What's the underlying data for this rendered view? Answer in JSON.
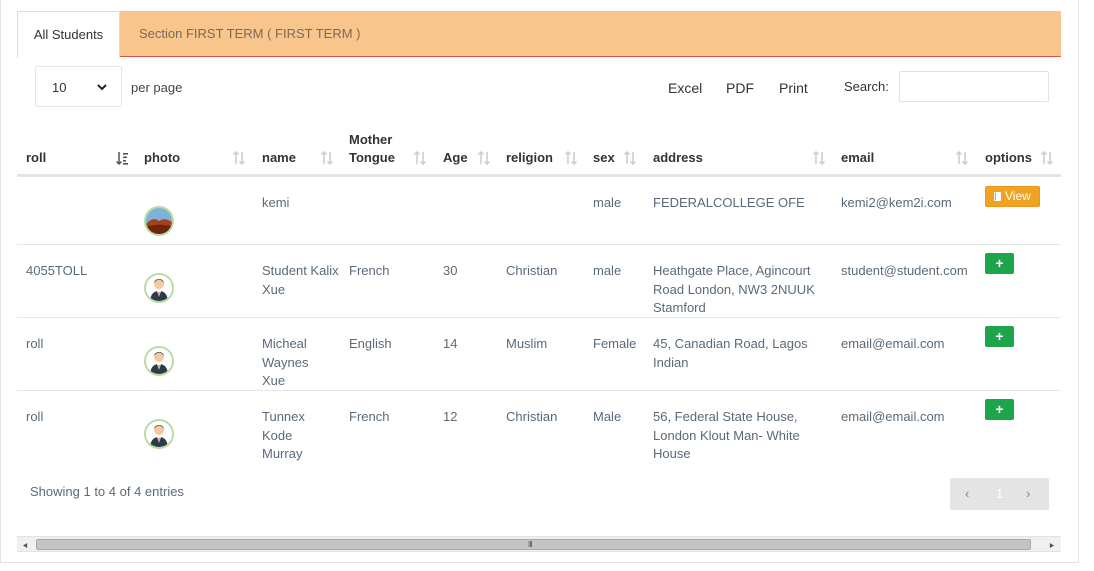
{
  "tabs": {
    "all_students": "All Students",
    "section": "Section FIRST TERM ( FIRST TERM )"
  },
  "controls": {
    "page_length": "10",
    "per_page_label": "per page",
    "excel": "Excel",
    "pdf": "PDF",
    "print": "Print",
    "search_label": "Search:",
    "search_value": ""
  },
  "table": {
    "columns": [
      "roll",
      "photo",
      "name",
      "Mother Tongue",
      "Age",
      "religion",
      "sex",
      "address",
      "email",
      "options"
    ],
    "mother_tongue_line1": "Mother",
    "mother_tongue_line2": "Tongue",
    "rows": [
      {
        "roll": "",
        "name": "kemi",
        "mother_tongue": "",
        "age": "",
        "religion": "",
        "sex": "male",
        "address": "FEDERALCOLLEGE OFE",
        "email": "kemi2@kem2i.com",
        "option": "View",
        "option_type": "view",
        "avatar": "landscape-photo-icon"
      },
      {
        "roll": "4055TOLL",
        "name": "Student Kalix Xue",
        "mother_tongue": "French",
        "age": "30",
        "religion": "Christian",
        "sex": "male",
        "address": "Heathgate Place, Agincourt Road London, NW3 2NUUK Stamford",
        "email": "student@student.com",
        "option": "+",
        "option_type": "add",
        "avatar": "person-icon"
      },
      {
        "roll": "roll",
        "name": "Micheal Waynes Xue",
        "mother_tongue": "English",
        "age": "14",
        "religion": "Muslim",
        "sex": "Female",
        "address": "45, Canadian Road, Lagos Indian",
        "email": "email@email.com",
        "option": "+",
        "option_type": "add",
        "avatar": "person-icon"
      },
      {
        "roll": "roll",
        "name": "Tunnex Kode Murray",
        "mother_tongue": "French",
        "age": "12",
        "religion": "Christian",
        "sex": "Male",
        "address": "56, Federal State House, London Klout Man- White House",
        "email": "email@email.com",
        "option": "+",
        "option_type": "add",
        "avatar": "person-icon"
      }
    ]
  },
  "footer": {
    "info": "Showing 1 to 4 of 4 entries",
    "prev": "‹",
    "page": "1",
    "next": "›"
  },
  "scrollbar": {
    "grip": "III"
  },
  "colors": {
    "tab_bar": "#f8c68d",
    "tab_underline": "#d9534f",
    "view_button": "#f0a320",
    "add_button": "#1ea54c",
    "cell_text": "#5a6a7a"
  }
}
